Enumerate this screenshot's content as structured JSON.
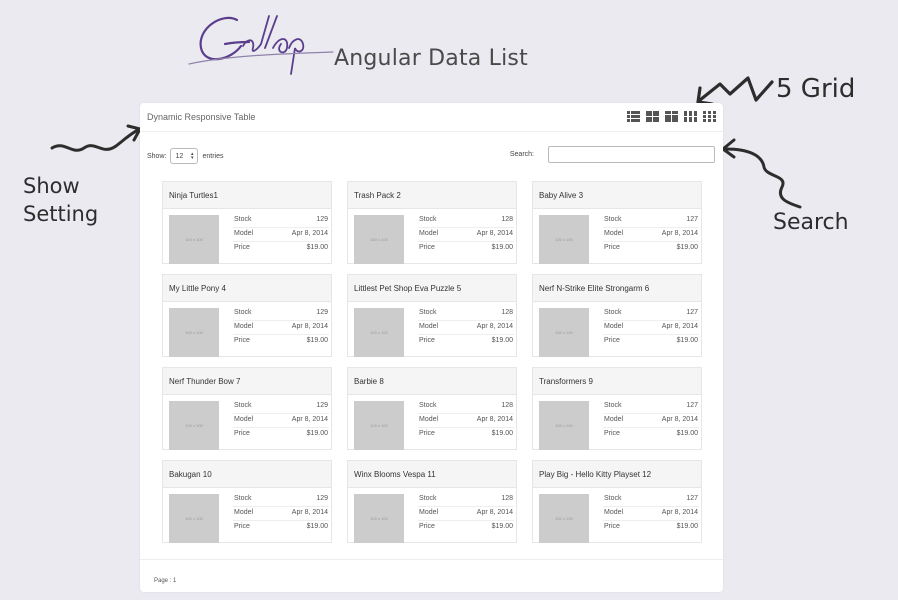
{
  "brand": {
    "subtitle": "Angular Data List"
  },
  "annotations": {
    "show_line1": "Show",
    "show_line2": "Setting",
    "grid": "5 Grid",
    "search": "Search"
  },
  "panel": {
    "title": "Dynamic Responsive Table",
    "view_icons": [
      "list-view-icon",
      "grid-2-icon",
      "grid-3-icon",
      "grid-4-icon",
      "grid-5-icon"
    ],
    "show_label": "Show:",
    "entries_value": "12",
    "entries_label": "entries",
    "search_label": "Search:",
    "search_value": "",
    "page_label": "Page : 1"
  },
  "card_labels": {
    "stock": "Stock",
    "model": "Model",
    "price": "Price",
    "thumb": "100 x 100"
  },
  "cards": [
    {
      "title": "Ninja Turtles1",
      "stock": "129",
      "model": "Apr 8, 2014",
      "price": "$19.00"
    },
    {
      "title": "Trash Pack 2",
      "stock": "128",
      "model": "Apr 8, 2014",
      "price": "$19.00"
    },
    {
      "title": "Baby Alive 3",
      "stock": "127",
      "model": "Apr 8, 2014",
      "price": "$19.00"
    },
    {
      "title": "My Little Pony 4",
      "stock": "129",
      "model": "Apr 8, 2014",
      "price": "$19.00"
    },
    {
      "title": "Littlest Pet Shop Eva Puzzle 5",
      "stock": "128",
      "model": "Apr 8, 2014",
      "price": "$19.00"
    },
    {
      "title": "Nerf N-Strike Elite Strongarm 6",
      "stock": "127",
      "model": "Apr 8, 2014",
      "price": "$19.00"
    },
    {
      "title": "Nerf Thunder Bow 7",
      "stock": "129",
      "model": "Apr 8, 2014",
      "price": "$19.00"
    },
    {
      "title": "Barbie 8",
      "stock": "128",
      "model": "Apr 8, 2014",
      "price": "$19.00"
    },
    {
      "title": "Transformers 9",
      "stock": "127",
      "model": "Apr 8, 2014",
      "price": "$19.00"
    },
    {
      "title": "Bakugan 10",
      "stock": "129",
      "model": "Apr 8, 2014",
      "price": "$19.00"
    },
    {
      "title": "Winx Blooms Vespa 11",
      "stock": "128",
      "model": "Apr 8, 2014",
      "price": "$19.00"
    },
    {
      "title": "Play Big - Hello Kitty Playset 12",
      "stock": "127",
      "model": "Apr 8, 2014",
      "price": "$19.00"
    }
  ]
}
